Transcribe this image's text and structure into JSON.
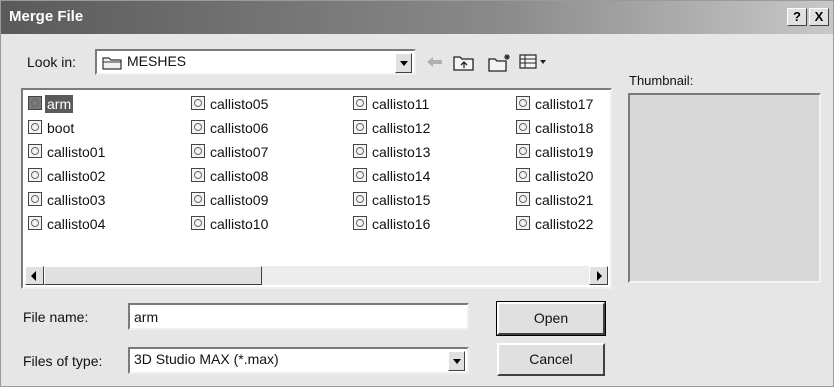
{
  "window": {
    "title": "Merge File",
    "help_label": "?",
    "close_label": "X"
  },
  "lookin": {
    "label": "Look in:",
    "value": "MESHES"
  },
  "toolbar": {
    "back_icon": "back-arrow-icon",
    "up_icon": "up-folder-icon",
    "new_folder_icon": "new-folder-icon",
    "view_icon": "view-menu-icon"
  },
  "files": [
    [
      "arm",
      "boot",
      "callisto01",
      "callisto02",
      "callisto03",
      "callisto04"
    ],
    [
      "callisto05",
      "callisto06",
      "callisto07",
      "callisto08",
      "callisto09",
      "callisto10"
    ],
    [
      "callisto11",
      "callisto12",
      "callisto13",
      "callisto14",
      "callisto15",
      "callisto16"
    ],
    [
      "callisto17",
      "callisto18",
      "callisto19",
      "callisto20",
      "callisto21",
      "callisto22"
    ]
  ],
  "selected_file": "arm",
  "thumbnail": {
    "label": "Thumbnail:"
  },
  "filename": {
    "label": "File name:",
    "value": "arm"
  },
  "filetype": {
    "label": "Files of type:",
    "value": "3D Studio MAX (*.max)"
  },
  "buttons": {
    "open": "Open",
    "cancel": "Cancel"
  }
}
